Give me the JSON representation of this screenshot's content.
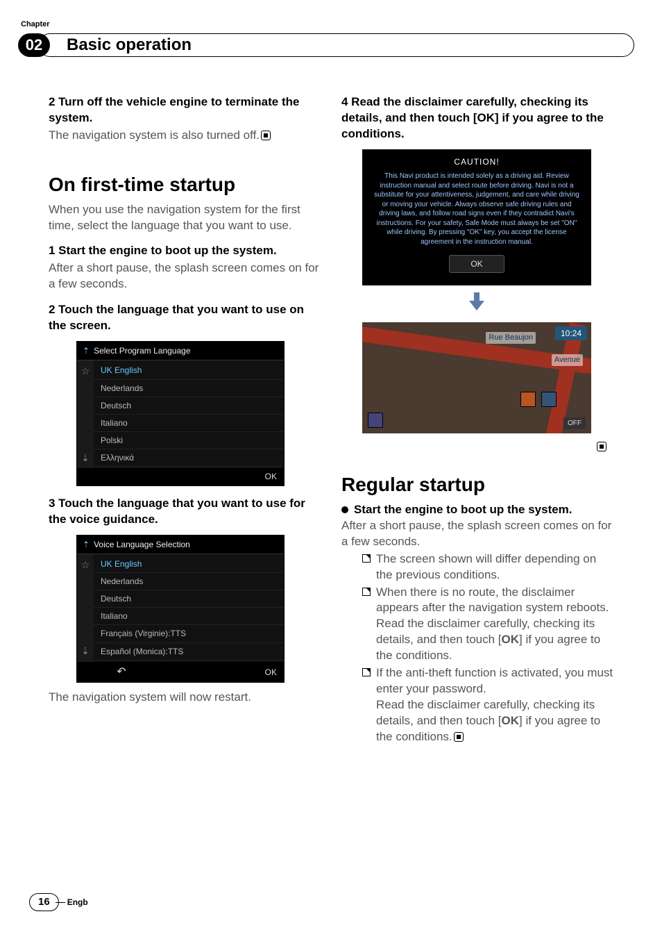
{
  "chapter": {
    "label": "Chapter",
    "number": "02",
    "title": "Basic operation"
  },
  "left": {
    "step2_title": "2    Turn off the vehicle engine to terminate the system.",
    "step2_body": "The navigation system is also turned off.",
    "h2a": "On first-time startup",
    "intro": "When you use the navigation system for the first time, select the language that you want to use.",
    "s1_title": "1    Start the engine to boot up the system.",
    "s1_body": "After a short pause, the splash screen comes on for a few seconds.",
    "s2_title": "2    Touch the language that you want to use on the screen.",
    "shot1": {
      "header": "Select Program Language",
      "items": [
        "UK English",
        "Nederlands",
        "Deutsch",
        "Italiano",
        "Polski",
        "Ελληνικά"
      ],
      "ok": "OK"
    },
    "s3_title": "3    Touch the language that you want to use for the voice guidance.",
    "shot2": {
      "header": "Voice Language Selection",
      "items": [
        "UK English",
        "Nederlands",
        "Deutsch",
        "Italiano",
        "Français (Virginie):TTS",
        "Español (Monica):TTS"
      ],
      "ok": "OK"
    },
    "restart": "The navigation system will now restart."
  },
  "right": {
    "step4_title": "4    Read the disclaimer carefully, checking its details, and then touch [OK] if you agree to the conditions.",
    "caution": {
      "title": "CAUTION!",
      "body": "This Navi product is intended solely as a driving aid. Review instruction manual and select route before driving. Navi is not a substitute for your attentiveness, judgement, and care while driving or moving your vehicle. Always observe safe driving rules and driving laws, and follow road signs even if they contradict Navi's instructions. For your safety, Safe Mode must always be set \"ON\" while driving. By pressing \"OK\" key, you accept the license agreement in the instruction manual.",
      "ok": "OK"
    },
    "map": {
      "street": "Rue Beaujon",
      "avenue": "Avenue",
      "clock": "10:24",
      "off": "OFF"
    },
    "h2b": "Regular startup",
    "bullet_title": "Start the engine to boot up the system.",
    "bullet_body": "After a short pause, the splash screen comes on for a few seconds.",
    "li1": "The screen shown will differ depending on the previous conditions.",
    "li2a": "When there is no route, the disclaimer appears after the navigation system reboots. Read the disclaimer carefully, checking its details, and then touch [",
    "li2b": "] if you agree to the conditions.",
    "li3a": "If the anti-theft function is activated, you must enter your password.",
    "li3b": "Read the disclaimer carefully, checking its details, and then touch [",
    "li3c": "] if you agree to the conditions.",
    "ok_bold": "OK"
  },
  "footer": {
    "page": "16",
    "lang": "Engb"
  }
}
